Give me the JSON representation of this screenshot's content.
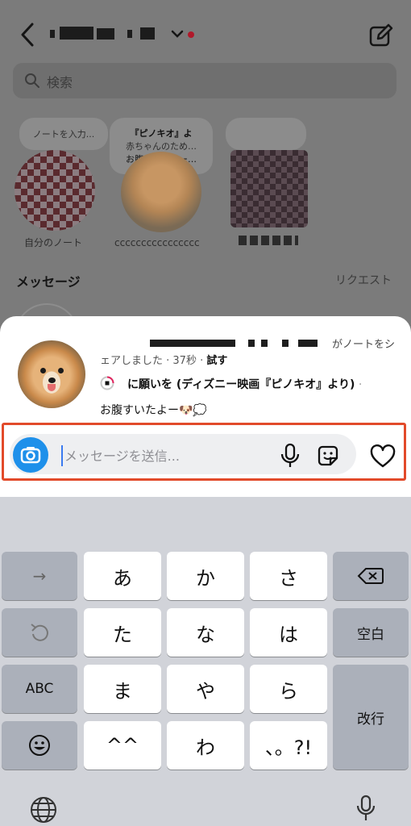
{
  "header": {
    "search_placeholder": "検索"
  },
  "notes": [
    {
      "bubble": "ノートを入力...",
      "caption": "自分のノート"
    },
    {
      "bubble_lines": [
        "『ピノキオ』よ",
        "赤ちゃんのため…",
        "お腹すいたよー…"
      ],
      "caption": "cccccccccccccccc"
    },
    {
      "bubble": "",
      "caption": ""
    }
  ],
  "messages": {
    "title": "メッセージ",
    "requests_label": "リクエスト"
  },
  "note_sheet": {
    "shared_suffix": "がノートをシ",
    "shared_line2_prefix": "ェアしました · 37秒 · ",
    "try_label": "試す",
    "music_title": "に願いを (ディズニー映画『ピノキオ』より)",
    "music_sep": " · ",
    "note_text": "お腹すいたよー🐶💭"
  },
  "composer": {
    "placeholder": "メッセージを送信...",
    "value": ""
  },
  "keyboard": {
    "row1": [
      "→",
      "あ",
      "か",
      "さ",
      "⌫"
    ],
    "row2": [
      "↺",
      "た",
      "な",
      "は",
      "空白"
    ],
    "row3": [
      "ABC",
      "ま",
      "や",
      "ら",
      "改行"
    ],
    "row4": [
      "☺",
      "^^",
      "わ",
      "、。?!"
    ],
    "bottom": [
      "globe-icon",
      "dictation-icon"
    ]
  },
  "colors": {
    "accent": "#1e90ea",
    "highlight": "#e24a2a",
    "notification": "#b0182a"
  }
}
